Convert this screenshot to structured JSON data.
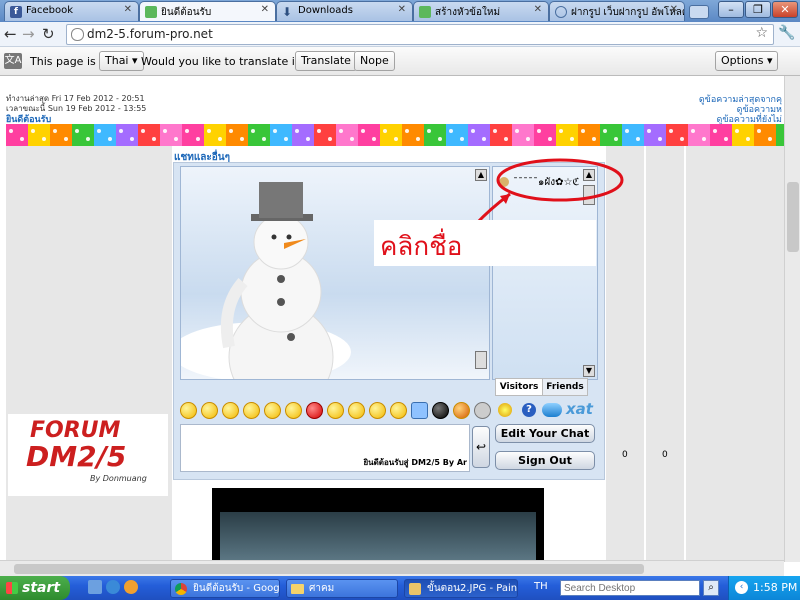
{
  "browser": {
    "tabs": [
      {
        "label": "Facebook",
        "icon": "facebook-icon",
        "color": "#3b5998"
      },
      {
        "label": "ยินดีต้อนรับ",
        "icon": "chat-icon",
        "color": "#5cb85c",
        "active": true
      },
      {
        "label": "Downloads",
        "icon": "download-icon",
        "color": "#4a6fa0"
      },
      {
        "label": "สร้างหัวข้อใหม่",
        "icon": "chat-icon",
        "color": "#5cb85c"
      },
      {
        "label": "ฝากรูป เว็บฝากรูป อัพโหลด",
        "icon": "globe-icon",
        "color": "#4a6fa0"
      }
    ],
    "window_buttons": {
      "minimize": "–",
      "maximize": "❐",
      "close": "✕"
    },
    "url": "dm2-5.forum-pro.net",
    "translate_bar": {
      "prefix": "This page is in",
      "language": "Thai",
      "question": "Would you like to translate it?",
      "translate_button": "Translate",
      "nope_button": "Nope",
      "options_button": "Options"
    }
  },
  "page": {
    "last_visit": "ทำงานล่าสุด Fri 17 Feb 2012 - 20:51",
    "current_time": "เวลาขณะนี้ Sun 19 Feb 2012 - 13:55",
    "welcome": "ยินดีต้อนรับ",
    "right_links": [
      "ดูข้อความล่าสุดจากคุ",
      "ดูข้อความห",
      "ดูข้อความที่ยังไม่"
    ],
    "stripe_colors": [
      "#ff3fa0",
      "#ffd200",
      "#ff8a00",
      "#39c639",
      "#3fb9ff",
      "#a46cff",
      "#ff4040"
    ],
    "section_title": "แชทและอื่นๆ",
    "annotation_text": "คลิกชื่อ",
    "annotation_color": "#e0101a",
    "chat": {
      "user_entry": "ˉˉˉˉˉ๑ผัง✿☆ℭ",
      "visitors_tab": "Visitors",
      "friends_tab": "Friends",
      "edit_button": "Edit Your Chat",
      "signout_button": "Sign Out",
      "footer": "ยินดีต้อนรับสู่ DM2/5 By Ar",
      "xat_label": "xat",
      "send_glyph": "↩"
    },
    "counts": [
      "0",
      "0"
    ],
    "logo": {
      "line1": "FORUM",
      "line2": "DM2/5",
      "line3": "By Donmuang"
    }
  },
  "taskbar": {
    "start": "start",
    "tasks": [
      {
        "label": "ยินดีต้อนรับ - Googl...",
        "icon": "chrome-icon"
      },
      {
        "label": "ศาคม",
        "icon": "folder-icon"
      },
      {
        "label": "ขั้นตอน2.JPG - Paint",
        "icon": "paint-icon",
        "active": true
      }
    ],
    "lang": "TH",
    "search_placeholder": "Search Desktop",
    "clock": "1:58 PM"
  }
}
